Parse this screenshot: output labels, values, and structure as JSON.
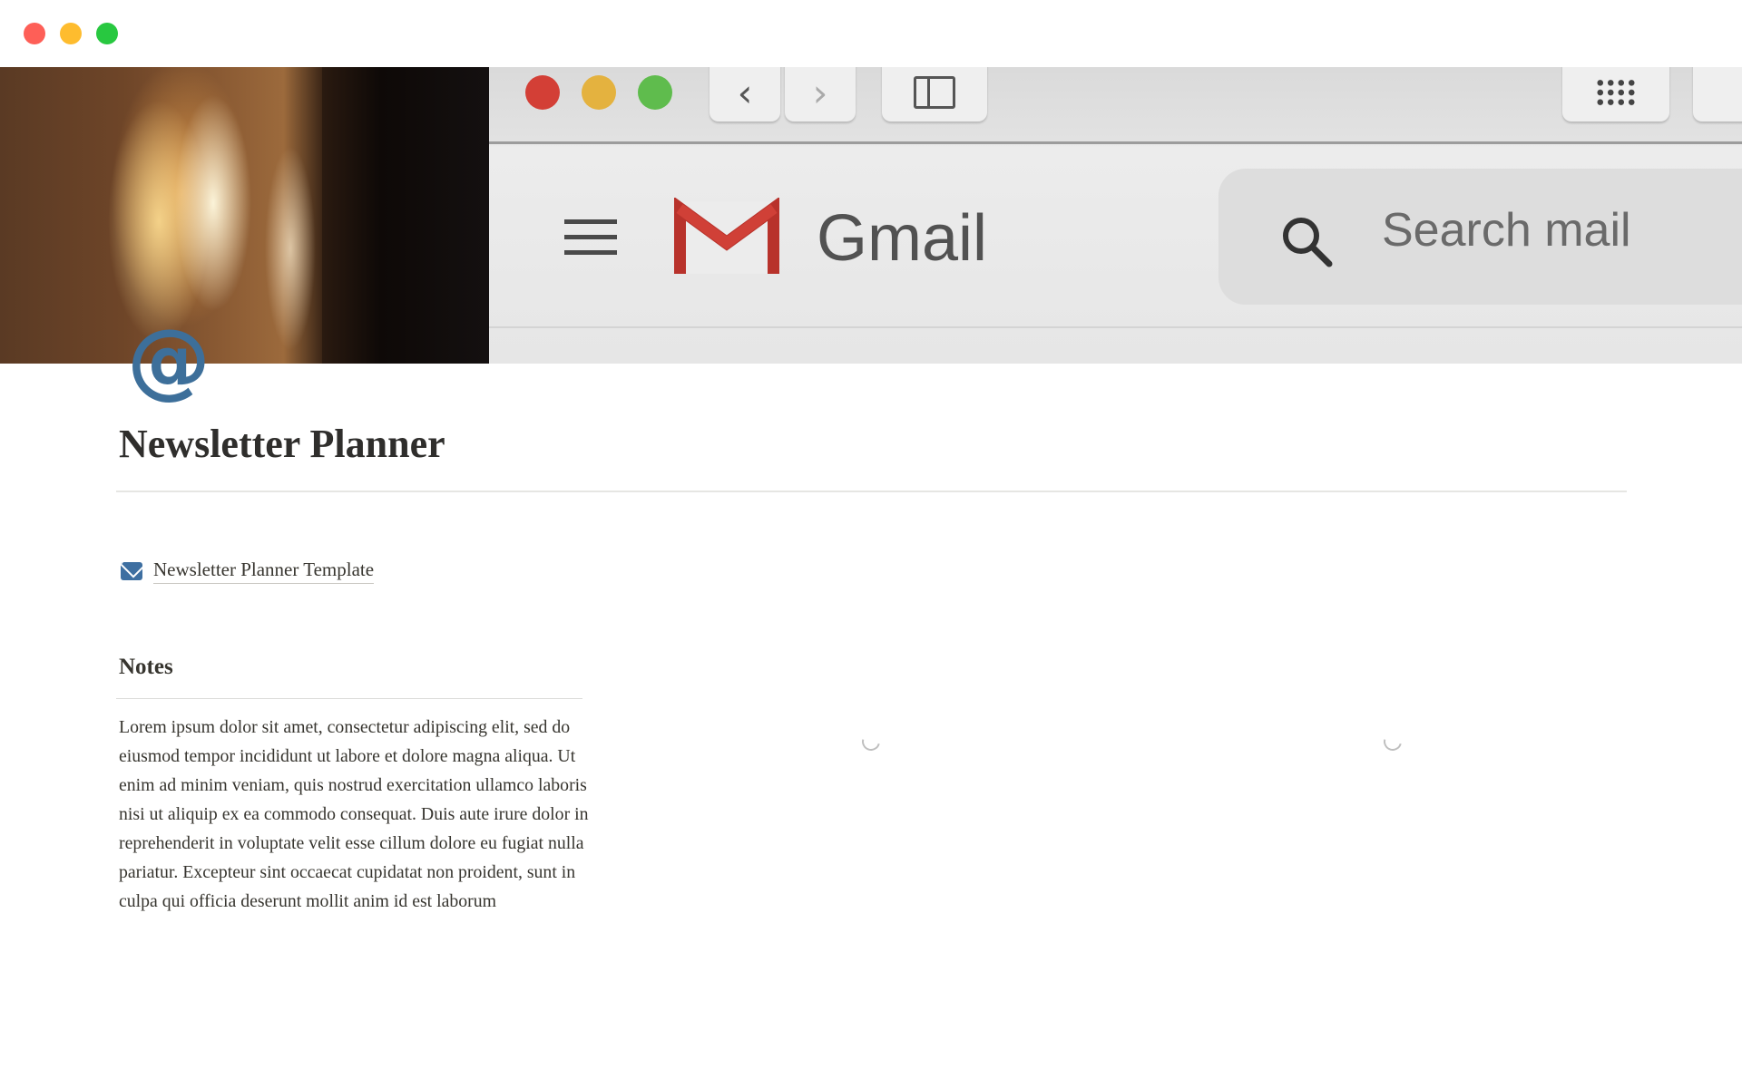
{
  "window": {
    "controls": [
      "close",
      "minimize",
      "maximize"
    ]
  },
  "cover": {
    "app_name": "Gmail",
    "search_placeholder": "Search mail",
    "icons": [
      "menu-icon",
      "gmail-logo-icon",
      "search-icon",
      "back-icon",
      "forward-icon",
      "sidebar-icon",
      "apps-grid-icon"
    ]
  },
  "page": {
    "icon": "@",
    "icon_name": "at-sign-icon",
    "title": "Newsletter Planner",
    "link": {
      "icon": "envelope-icon",
      "label": "Newsletter Planner Template"
    },
    "notes": {
      "heading": "Notes",
      "body": "Lorem ipsum dolor sit amet, consectetur adipiscing elit, sed do eiusmod tempor incididunt ut labore et dolore magna aliqua. Ut enim ad minim veniam, quis nostrud exercitation ullamco laboris nisi ut aliquip ex ea commodo consequat. Duis aute irure dolor in reprehenderit in voluptate velit esse cillum dolore eu fugiat nulla pariatur. Excepteur sint occaecat cupidatat non proident, sunt in culpa qui officia deserunt mollit anim id est laborum"
    }
  },
  "colors": {
    "accent_blue": "#3d6f9a",
    "close": "#fe5f57",
    "minimize": "#febc2e",
    "maximize": "#28c840",
    "gmail_red": "#c5221f"
  }
}
